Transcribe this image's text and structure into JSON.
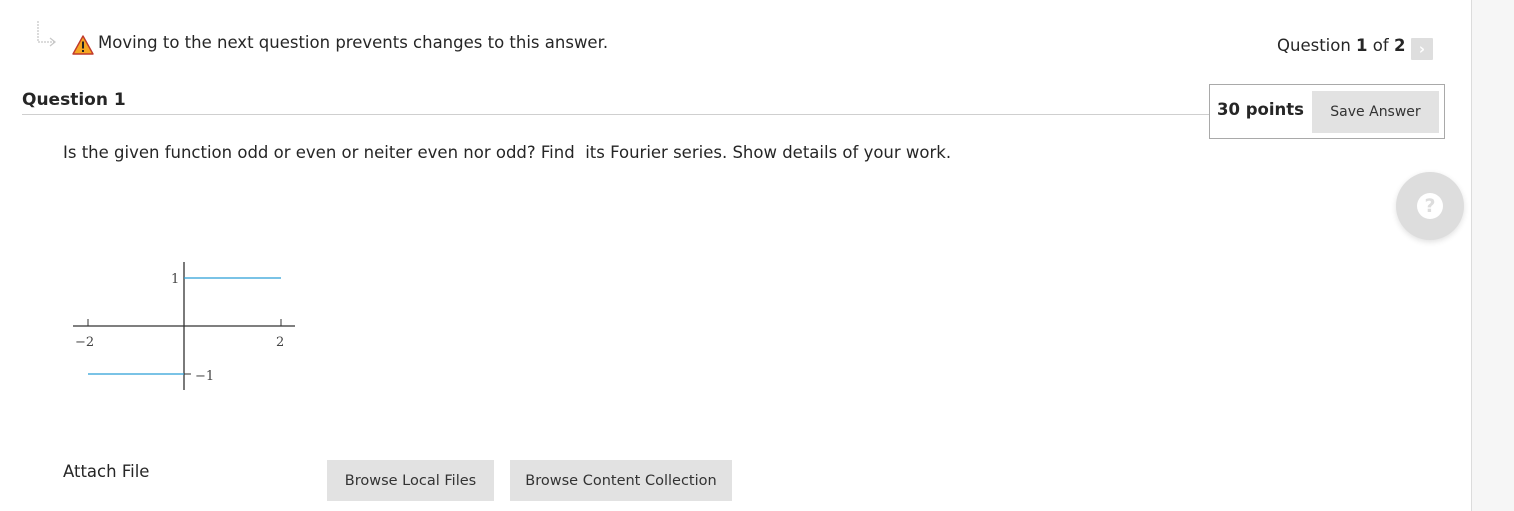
{
  "header": {
    "warning_text": "Moving to the next question prevents changes to this answer.",
    "counter_prefix": "Question ",
    "current": "1",
    "counter_of": " of ",
    "total": "2",
    "next_icon": "chevron-right-icon"
  },
  "question": {
    "title": "Question 1",
    "points": "30 points",
    "save_label": "Save Answer",
    "text": "Is the given function odd or even or neiter even nor odd? Find  its Fourier series. Show details of your work."
  },
  "graph": {
    "tick_labels": {
      "x_neg": "−2",
      "x_pos": "2",
      "y_pos": "1",
      "y_neg": "−1"
    },
    "line_color": "#2a9fd6"
  },
  "attach": {
    "label": "Attach File",
    "browse_local": "Browse Local Files",
    "browse_collection": "Browse Content Collection"
  },
  "help": {
    "icon": "help-icon"
  }
}
